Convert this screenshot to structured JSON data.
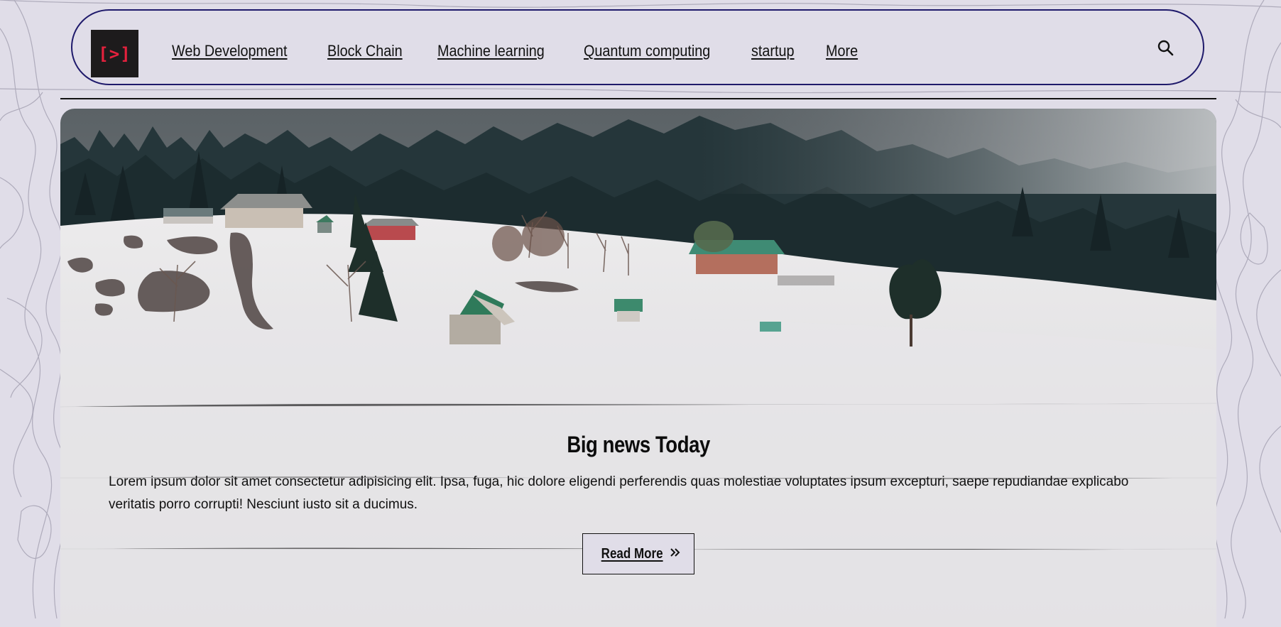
{
  "logo": {
    "text": "[>]",
    "accent": "#e5213d",
    "bg": "#1d1b1c"
  },
  "nav": {
    "items": [
      {
        "label": "Web Development"
      },
      {
        "label": "Block Chain"
      },
      {
        "label": "Machine learning"
      },
      {
        "label": "Quantum computing"
      },
      {
        "label": "startup"
      },
      {
        "label": "More"
      }
    ],
    "search_icon": "search-icon",
    "border_color": "#1f1a6b"
  },
  "hero": {
    "image": "snowy-village-hillside",
    "title": "Big news Today",
    "text": "Lorem ipsum dolor sit amet consectetur adipisicing elit. Ipsa, fuga, hic dolore eligendi perferendis quas molestiae voluptates ipsum excepturi, saepe repudiandae explicabo veritatis porro corrupti! Nesciunt iusto sit a ducimus.",
    "button": {
      "label": "Read More",
      "icon": "double-chevron-right-icon"
    }
  },
  "colors": {
    "page_bg": "#e0dde8",
    "text": "#111111"
  }
}
